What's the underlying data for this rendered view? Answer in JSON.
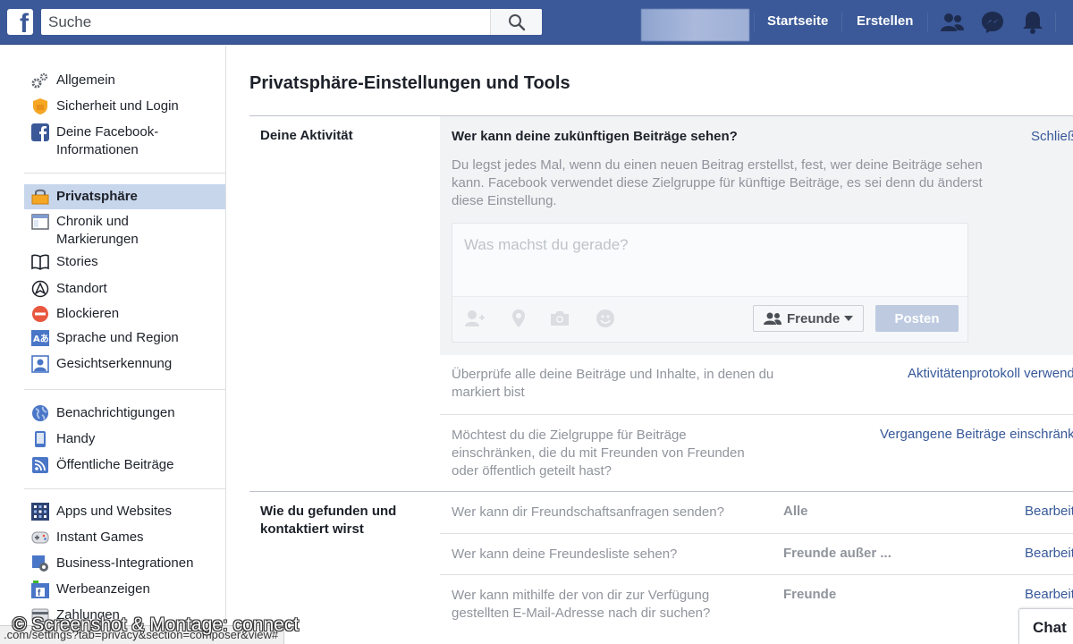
{
  "header": {
    "logo": "f",
    "search_placeholder": "Suche",
    "nav": {
      "home": "Startseite",
      "create": "Erstellen"
    },
    "icons": [
      "friends-icon",
      "messenger-icon",
      "notifications-icon"
    ]
  },
  "sidebar": {
    "items": [
      {
        "label": "Allgemein",
        "icon": "gear-icon"
      },
      {
        "label": "Sicherheit und Login",
        "icon": "shield-icon"
      },
      {
        "label": "Deine Facebook-Informationen",
        "icon": "facebook-icon"
      },
      {
        "label": "Privatsphäre",
        "icon": "lock-icon",
        "active": true
      },
      {
        "label": "Chronik und Markierungen",
        "icon": "timeline-icon"
      },
      {
        "label": "Stories",
        "icon": "book-icon"
      },
      {
        "label": "Standort",
        "icon": "location-icon"
      },
      {
        "label": "Blockieren",
        "icon": "block-icon"
      },
      {
        "label": "Sprache und Region",
        "icon": "language-icon"
      },
      {
        "label": "Gesichtserkennung",
        "icon": "face-recognition-icon"
      },
      {
        "label": "Benachrichtigungen",
        "icon": "globe-icon"
      },
      {
        "label": "Handy",
        "icon": "phone-icon"
      },
      {
        "label": "Öffentliche Beiträge",
        "icon": "rss-icon"
      },
      {
        "label": "Apps und Websites",
        "icon": "apps-icon"
      },
      {
        "label": "Instant Games",
        "icon": "gamepad-icon"
      },
      {
        "label": "Business-Integrationen",
        "icon": "business-icon"
      },
      {
        "label": "Werbeanzeigen",
        "icon": "ads-icon"
      },
      {
        "label": "Zahlungen",
        "icon": "payment-icon"
      }
    ]
  },
  "main": {
    "title": "Privatsphäre-Einstellungen und Tools",
    "sections": [
      {
        "label": "Deine Aktivität",
        "expanded": {
          "question": "Wer kann deine zukünftigen Beiträge sehen?",
          "close": "Schließen",
          "description": "Du legst jedes Mal, wenn du einen neuen Beitrag erstellst, fest, wer deine Beiträge sehen kann. Facebook verwendet diese Zielgruppe für künftige Beiträge, es sei denn du änderst diese Einstellung.",
          "composer_placeholder": "Was machst du gerade?",
          "audience": "Freunde",
          "post": "Posten"
        },
        "rows": [
          {
            "text": "Überprüfe alle deine Beiträge und Inhalte, in denen du markiert bist",
            "link": "Aktivitätenprotokoll verwenden"
          },
          {
            "text": "Möchtest du die Zielgruppe für Beiträge einschränken, die du mit Freunden von Freunden oder öffentlich geteilt hast?",
            "link": "Vergangene Beiträge einschränken"
          }
        ]
      },
      {
        "label": "Wie du gefunden und kontaktiert wirst",
        "rows": [
          {
            "text": "Wer kann dir Freundschaftsanfragen senden?",
            "value": "Alle",
            "link": "Bearbeiten"
          },
          {
            "text": "Wer kann deine Freundesliste sehen?",
            "value": "Freunde außer ...",
            "link": "Bearbeiten"
          },
          {
            "text": "Wer kann mithilfe der von dir zur Verfügung gestellten E-Mail-Adresse nach dir suchen?",
            "value": "Freunde",
            "link": "Bearbeiten"
          }
        ]
      }
    ]
  },
  "chat": "Chat",
  "status_url": ".com/settings?tab=privacy&section=composer&view#",
  "watermark": "© Screenshot & Montage: connect",
  "colors": {
    "brand": "#3b5998",
    "link": "#365899",
    "active": "#c8d6ec"
  }
}
